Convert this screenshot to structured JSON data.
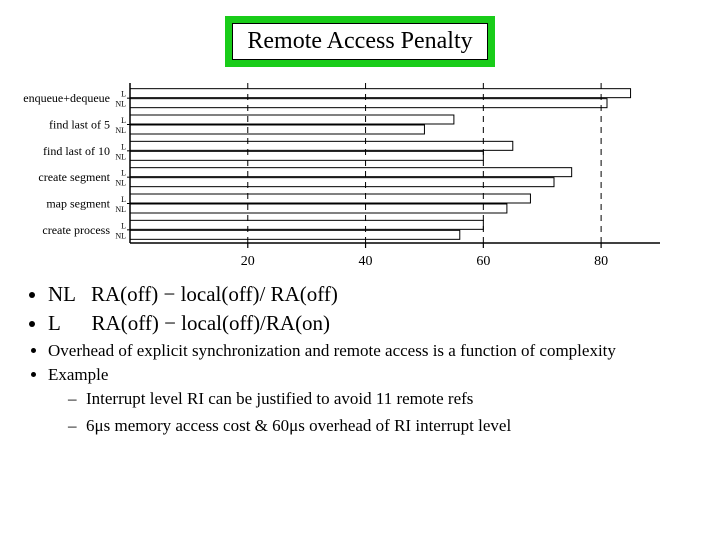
{
  "title": "Remote Access Penalty",
  "chart_data": {
    "type": "bar",
    "orientation": "horizontal",
    "x_ticks": [
      20,
      40,
      60,
      80
    ],
    "xlim": [
      0,
      90
    ],
    "sublabels": [
      "L",
      "NL"
    ],
    "categories": [
      "enqueue+dequeue",
      "find last of 5",
      "find last of 10",
      "create segment",
      "map segment",
      "create process"
    ],
    "series": [
      {
        "name": "L",
        "values": [
          85,
          55,
          65,
          75,
          68,
          60
        ]
      },
      {
        "name": "NL",
        "values": [
          81,
          50,
          60,
          72,
          64,
          56
        ]
      }
    ]
  },
  "bullets": {
    "line1_nl": "NL   RA(off) − local(off)/ RA(off)",
    "line2_l": "L      RA(off) − local(off)/RA(on)",
    "overhead": "Overhead of explicit synchronization and remote access is a function of complexity",
    "example_label": "Example",
    "sub1": "Interrupt level RI can be justified to avoid 11 remote refs",
    "sub2": "6μs memory access cost & 60μs overhead of RI interrupt level"
  }
}
